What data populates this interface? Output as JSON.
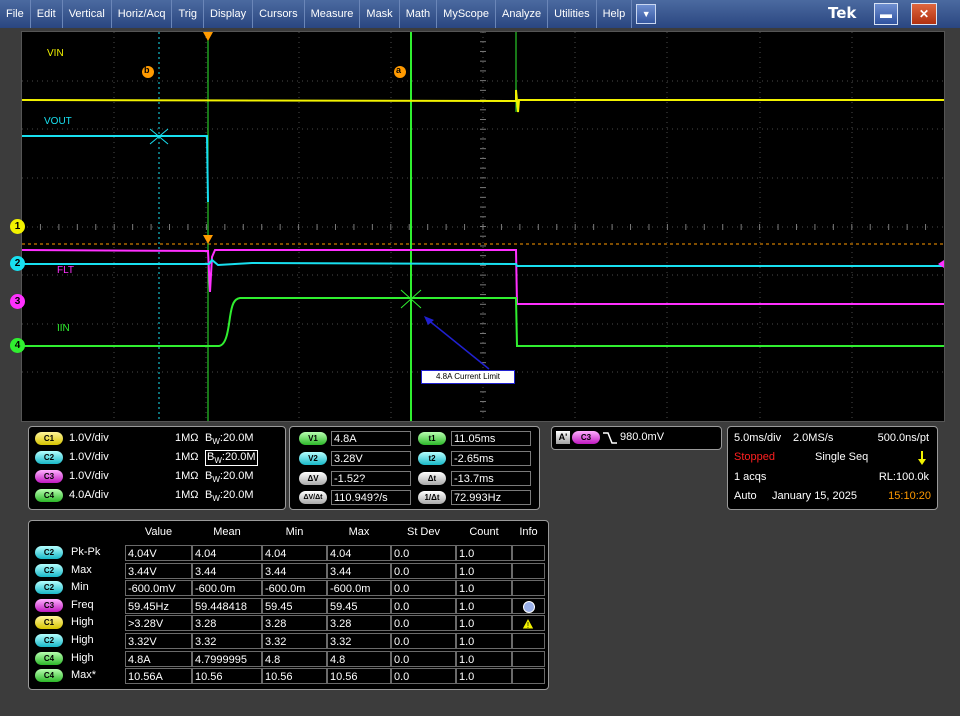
{
  "menu": [
    "File",
    "Edit",
    "Vertical",
    "Horiz/Acq",
    "Trig",
    "Display",
    "Cursors",
    "Measure",
    "Mask",
    "Math",
    "MyScope",
    "Analyze",
    "Utilities",
    "Help"
  ],
  "brand": "Tek",
  "colors": {
    "c1": "#f2f200",
    "c2": "#18e0f0",
    "c3": "#ff30ff",
    "c4": "#30ef30",
    "trigger": "#ff9a00"
  },
  "waveform_labels": {
    "vin": "VIN",
    "vout": "VOUT",
    "flt": "FLT",
    "iin": "IIN",
    "cursor_b": "b",
    "cursor_a": "a",
    "annotation": "4.8A Current Limit"
  },
  "channel_markers": [
    "1",
    "2",
    "3",
    "4"
  ],
  "channels": [
    {
      "badge": "C1",
      "scale": "1.0V/div",
      "coupling": "1MΩ",
      "bw_label": "B",
      "bw_sub": "W",
      "bw_value": ":20.0M"
    },
    {
      "badge": "C2",
      "scale": "1.0V/div",
      "coupling": "1MΩ",
      "bw_label": "B",
      "bw_sub": "W",
      "bw_value": ":20.0M"
    },
    {
      "badge": "C3",
      "scale": "1.0V/div",
      "coupling": "1MΩ",
      "bw_label": "B",
      "bw_sub": "W",
      "bw_value": ":20.0M"
    },
    {
      "badge": "C4",
      "scale": "4.0A/div",
      "coupling": "1MΩ",
      "bw_label": "B",
      "bw_sub": "W",
      "bw_value": ":20.0M"
    }
  ],
  "cursors": {
    "v1_label": "V1",
    "v1": "4.8A",
    "v2_label": "V2",
    "v2": "3.28V",
    "dv_label": "ΔV",
    "dv": "-1.52?",
    "dvdt_label": "ΔV/Δt",
    "dvdt": "110.949?/s",
    "t1_label": "t1",
    "t1": "11.05ms",
    "t2_label": "t2",
    "t2": "-2.65ms",
    "dt_label": "Δt",
    "dt": "-13.7ms",
    "inv_dt_label": "1/Δt",
    "inv_dt": "72.993Hz"
  },
  "trigger": {
    "source_tag": "A'",
    "channel": "C3",
    "slope": "falling",
    "level": "980.0mV"
  },
  "horizontal": {
    "scale": "5.0ms/div",
    "rate": "2.0MS/s",
    "resolution": "500.0ns/pt",
    "state": "Stopped",
    "mode": "Single Seq",
    "acqs": "1 acqs",
    "record": "RL:100.0k",
    "trigger_mode": "Auto",
    "date": "January 15, 2025",
    "time": "15:10:20"
  },
  "measurements": {
    "headers": [
      "Value",
      "Mean",
      "Min",
      "Max",
      "St Dev",
      "Count",
      "Info"
    ],
    "rows": [
      {
        "ch": "C2",
        "name": "Pk-Pk",
        "value": "4.04V",
        "mean": "4.04",
        "min": "4.04",
        "max": "4.04",
        "stdev": "0.0",
        "count": "1.0",
        "info": ""
      },
      {
        "ch": "C2",
        "name": "Max",
        "value": "3.44V",
        "mean": "3.44",
        "min": "3.44",
        "max": "3.44",
        "stdev": "0.0",
        "count": "1.0",
        "info": ""
      },
      {
        "ch": "C2",
        "name": "Min",
        "value": "-600.0mV",
        "mean": "-600.0m",
        "min": "-600.0m",
        "max": "-600.0m",
        "stdev": "0.0",
        "count": "1.0",
        "info": ""
      },
      {
        "ch": "C3",
        "name": "Freq",
        "value": "59.45Hz",
        "mean": "59.448418",
        "min": "59.45",
        "max": "59.45",
        "stdev": "0.0",
        "count": "1.0",
        "info": "info-icon"
      },
      {
        "ch": "C1",
        "name": "High",
        "value": ">3.28V",
        "mean": "3.28",
        "min": "3.28",
        "max": "3.28",
        "stdev": "0.0",
        "count": "1.0",
        "info": "warning-icon"
      },
      {
        "ch": "C2",
        "name": "High",
        "value": "3.32V",
        "mean": "3.32",
        "min": "3.32",
        "max": "3.32",
        "stdev": "0.0",
        "count": "1.0",
        "info": ""
      },
      {
        "ch": "C4",
        "name": "High",
        "value": "4.8A",
        "mean": "4.7999995",
        "min": "4.8",
        "max": "4.8",
        "stdev": "0.0",
        "count": "1.0",
        "info": ""
      },
      {
        "ch": "C4",
        "name": "Max*",
        "value": "10.56A",
        "mean": "10.56",
        "min": "10.56",
        "max": "10.56",
        "stdev": "0.0",
        "count": "1.0",
        "info": ""
      }
    ]
  }
}
